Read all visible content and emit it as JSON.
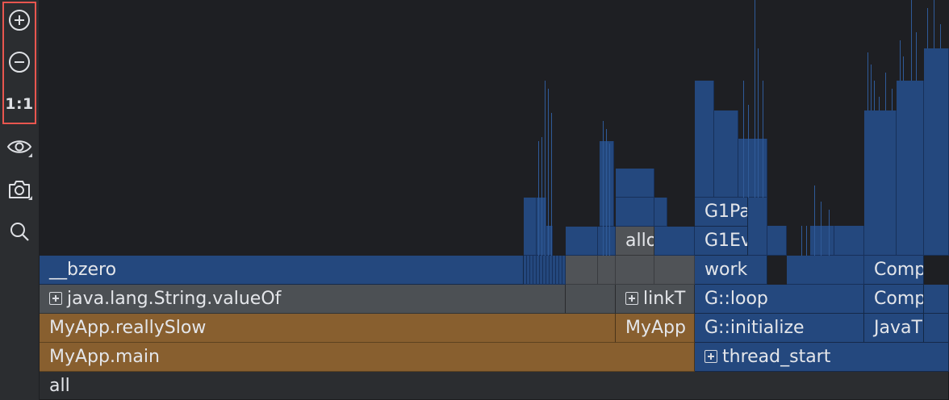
{
  "toolbar": {
    "zoom_in_icon": "plus-circle",
    "zoom_out_icon": "minus-circle",
    "reset_zoom_label": "1:1",
    "visibility_icon": "eye",
    "snapshot_icon": "camera",
    "search_icon": "magnifier"
  },
  "colors": {
    "java_frame": "#885f2f",
    "native_frame": "#24487e",
    "jdk_frame": "#505357",
    "highlight": "#e8564f"
  },
  "frames": {
    "all": "all",
    "main": "MyApp.main",
    "thread_start": "thread_start",
    "really_slow": "MyApp.reallySlow",
    "myapp_truncated": "MyApp",
    "g_initialize": "G::initialize",
    "java_truncated": "JavaT",
    "string_valueof": "java.lang.String.valueOf",
    "linkt": "linkT",
    "g_loop": "G::loop",
    "comp1": "Comp",
    "bzero": "__bzero",
    "work": "work",
    "comp2": "Comp",
    "allo": "allo",
    "g1ev": "G1Ev",
    "g1pa": "G1Pa"
  }
}
